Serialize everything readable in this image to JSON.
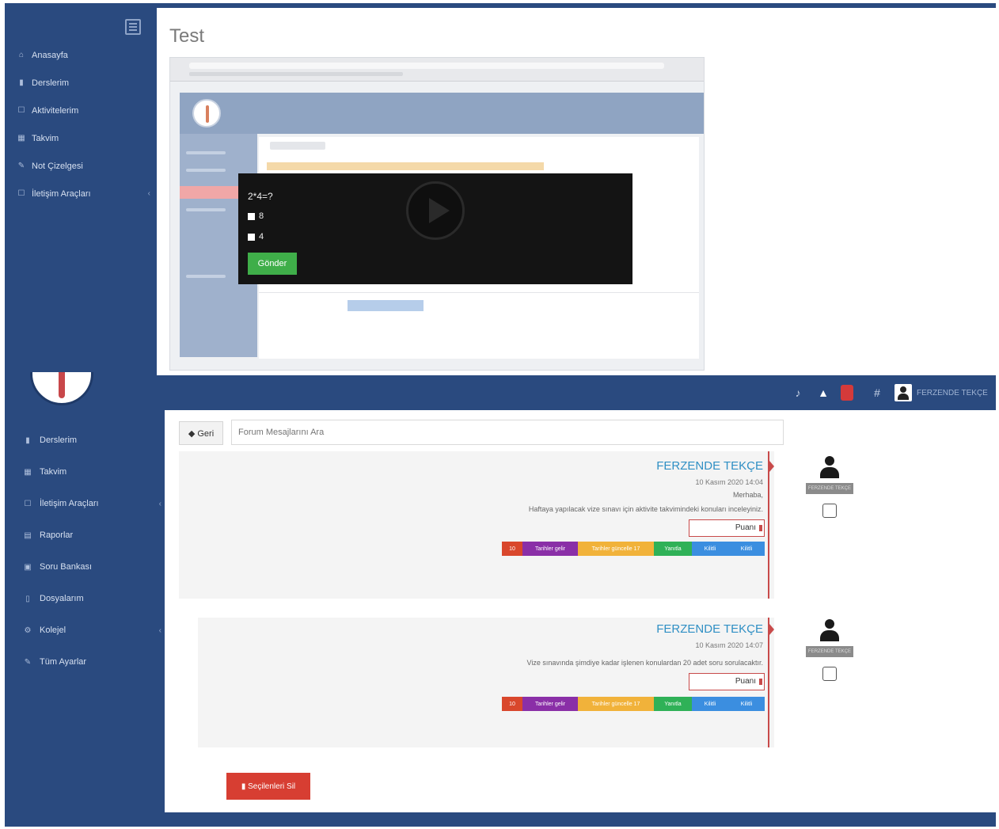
{
  "top": {
    "page_title": "Test",
    "sidebar": {
      "items": [
        {
          "icon": "home-icon",
          "glyph": "⌂",
          "label": "Anasayfa"
        },
        {
          "icon": "book-icon",
          "glyph": "▮",
          "label": "Derslerim"
        },
        {
          "icon": "activity-icon",
          "glyph": "☐",
          "label": "Aktivitelerim"
        },
        {
          "icon": "calendar-icon",
          "glyph": "▦",
          "label": "Takvim"
        },
        {
          "icon": "pencil-icon",
          "glyph": "✎",
          "label": "Not Çizelgesi"
        },
        {
          "icon": "comment-icon",
          "glyph": "☐",
          "label": "İletişim Araçları",
          "arrow": "‹"
        }
      ]
    },
    "video": {
      "question": "2*4=?",
      "options": [
        "8",
        "4"
      ],
      "submit_label": "Gönder"
    }
  },
  "topbar": {
    "user_name": "FERZENDE TEKÇE"
  },
  "bottom": {
    "sidebar": {
      "items": [
        {
          "icon": "book-icon",
          "glyph": "▮",
          "label": "Derslerim"
        },
        {
          "icon": "calendar-icon",
          "glyph": "▦",
          "label": "Takvim"
        },
        {
          "icon": "comment-icon",
          "glyph": "☐",
          "label": "İletişim Araçları",
          "arrow": "‹"
        },
        {
          "icon": "report-icon",
          "glyph": "▤",
          "label": "Raporlar"
        },
        {
          "icon": "question-bank-icon",
          "glyph": "▣",
          "label": "Soru Bankası"
        },
        {
          "icon": "file-icon",
          "glyph": "▯",
          "label": "Dosyalarım"
        },
        {
          "icon": "cogs-icon",
          "glyph": "⚙",
          "label": "Kolejel",
          "arrow": "‹"
        },
        {
          "icon": "wrench-icon",
          "glyph": "✎",
          "label": "Tüm Ayarlar"
        }
      ]
    },
    "back_label": "Geri",
    "search_placeholder": "Forum Mesajlarını Ara",
    "posts": [
      {
        "author": "FERZENDE TEKÇE",
        "date": "10 Kasım 2020 14:04",
        "greeting": "Merhaba,",
        "message": "Haftaya yapılacak vize sınavı için aktivite takvimindeki konuları inceleyiniz.",
        "score_label": "Puanı",
        "actions": [
          "10",
          "Tarihler gelir",
          "Tarihler güncelle 17",
          "Yanıtla",
          "Kilitli",
          "Kilitli"
        ]
      },
      {
        "author": "FERZENDE TEKÇE",
        "date": "10 Kasım 2020 14:07",
        "greeting": "",
        "message": "Vize sınavında şimdiye kadar işlenen konulardan 20 adet soru sorulacaktır.",
        "score_label": "Puanı",
        "actions": [
          "10",
          "Tarihler gelir",
          "Tarihler güncelle 17",
          "Yanıtla",
          "Kilitli",
          "Kilitli"
        ]
      }
    ],
    "user_card_name": "FERZENDE TEKÇE",
    "delete_label": "Seçilenleri Sil"
  }
}
